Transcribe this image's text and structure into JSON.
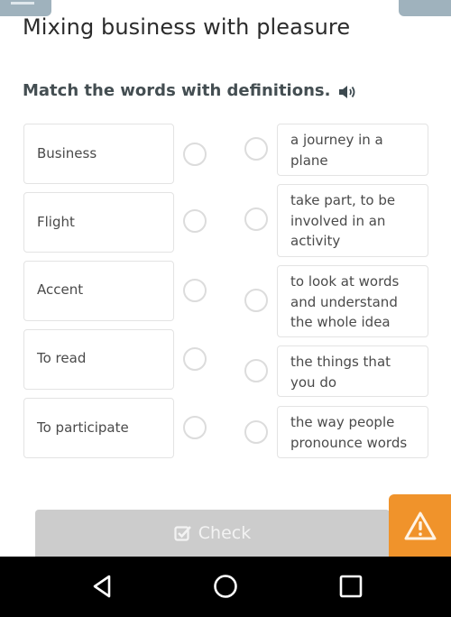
{
  "header": {
    "title": "Mixing business with pleasure",
    "instruction": "Match the words with definitions.",
    "icons": {
      "menu": "menu-icon",
      "close": "close-icon",
      "speaker": "speaker-icon"
    }
  },
  "exercise": {
    "words": [
      {
        "label": "Business"
      },
      {
        "label": "Flight"
      },
      {
        "label": "Accent"
      },
      {
        "label": "To read"
      },
      {
        "label": "To participate"
      }
    ],
    "definitions": [
      {
        "label": "a journey in a plane"
      },
      {
        "label": "take part, to be involved in an activity"
      },
      {
        "label": "to look at words and understand the whole idea"
      },
      {
        "label": "the things that you do"
      },
      {
        "label": "the way people pronounce words"
      }
    ]
  },
  "footer": {
    "check_label": "Check",
    "check_icon": "checkbox-icon",
    "report_icon": "warning-icon"
  },
  "navbar": {
    "back_icon": "back-icon",
    "home_icon": "home-icon",
    "recent_icon": "recent-apps-icon"
  },
  "colors": {
    "accent_orange": "#f0932b",
    "button_disabled": "#cccccc",
    "header_button": "#9fb2bd",
    "radio_border": "#dcdcdc",
    "box_border": "#e3e3e3"
  }
}
